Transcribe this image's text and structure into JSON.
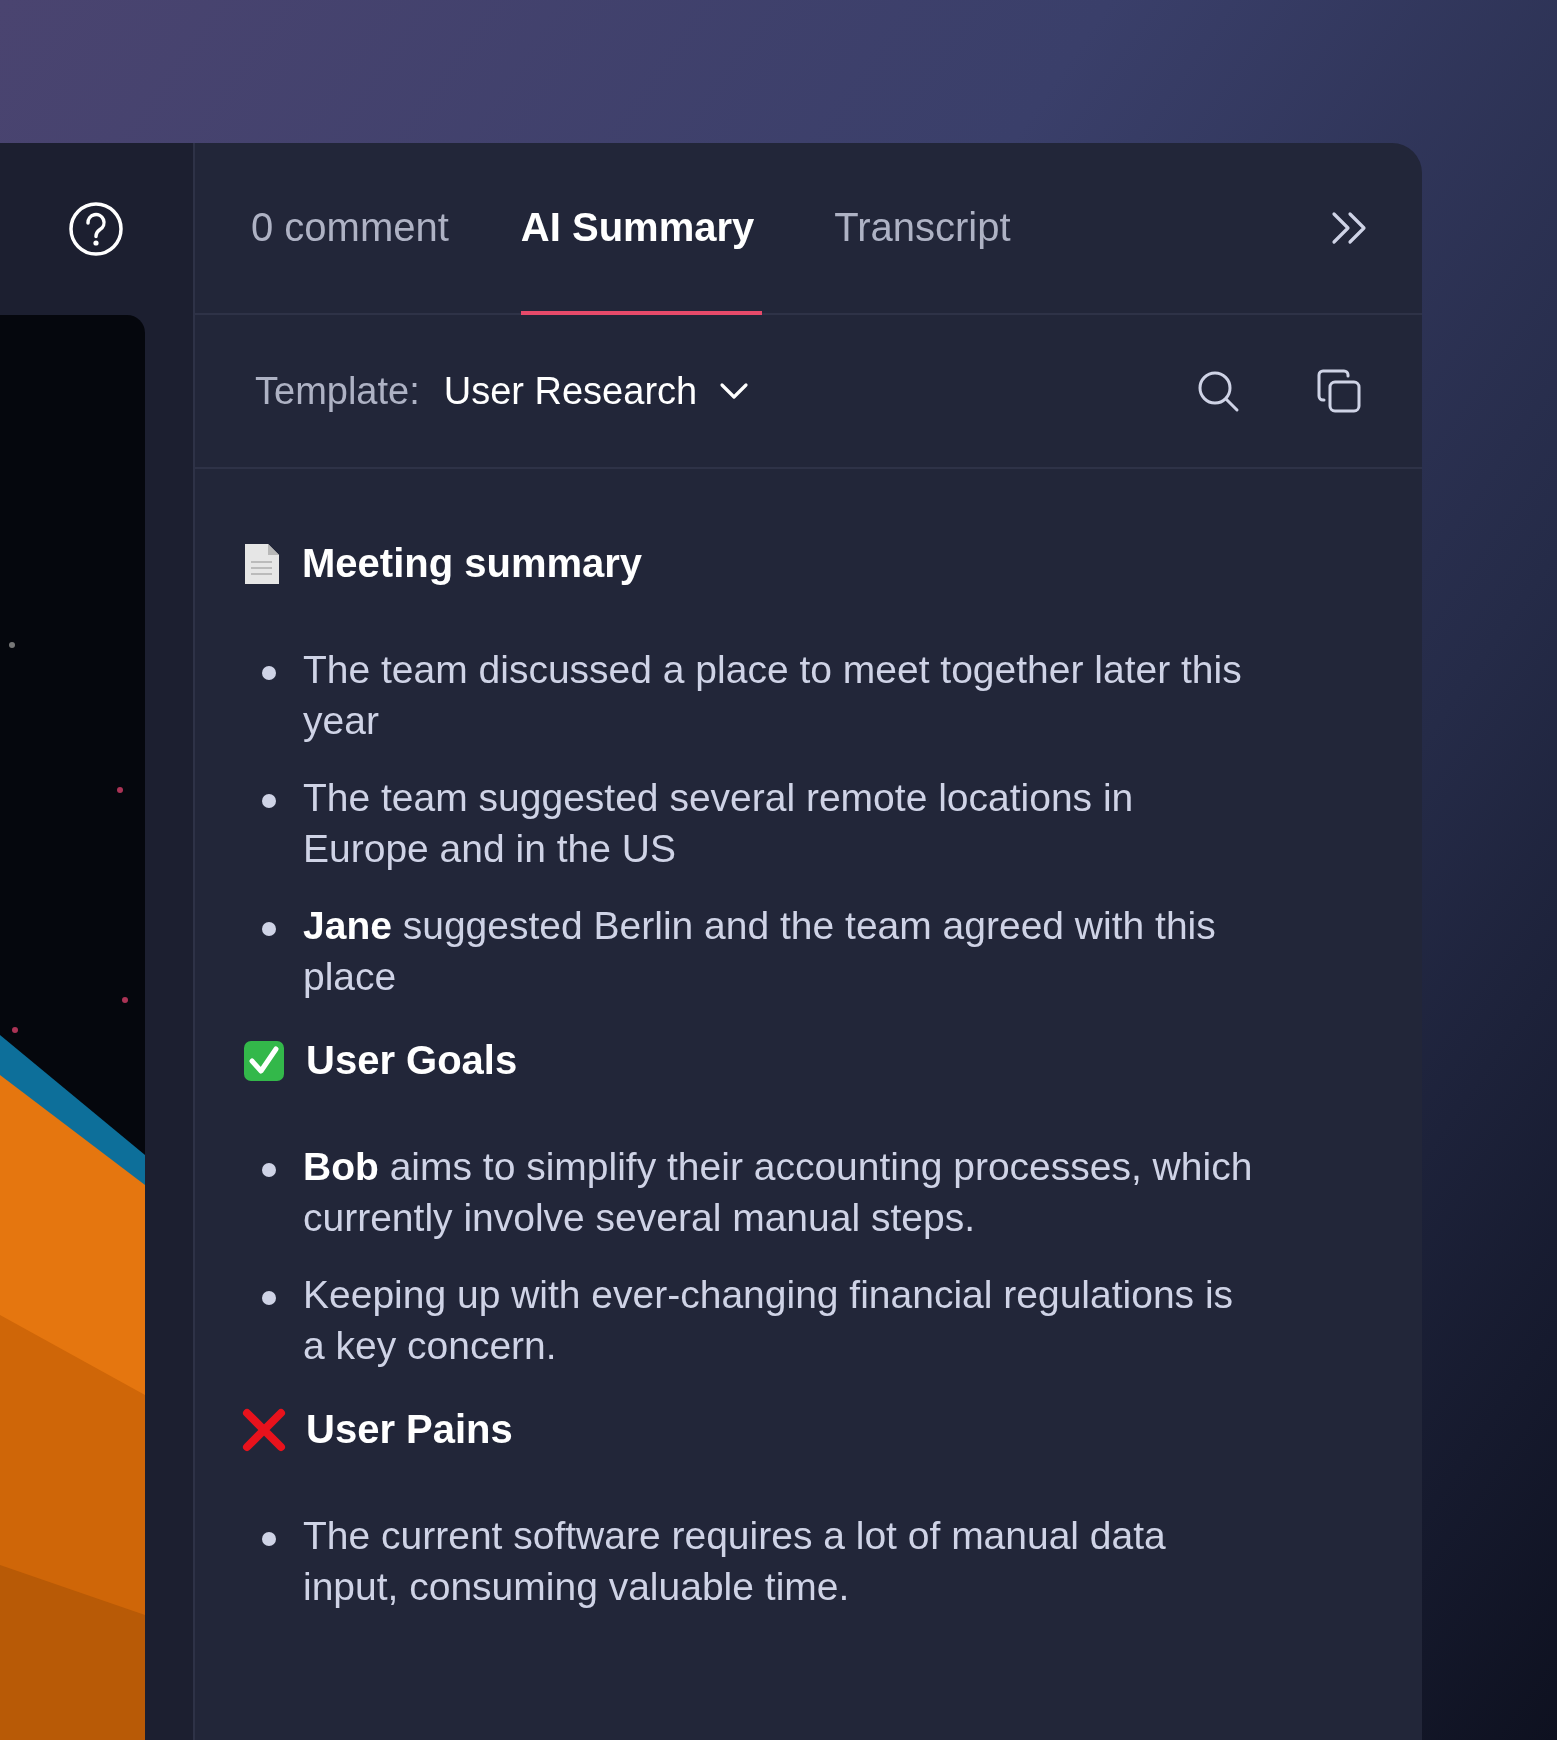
{
  "tabs": [
    {
      "label": "0 comment",
      "selected": false
    },
    {
      "label": "AI Summary",
      "selected": true
    },
    {
      "label": "Transcript",
      "selected": false
    }
  ],
  "template": {
    "label": "Template:",
    "value": "User Research"
  },
  "sections": [
    {
      "kind": "document",
      "title": "Meeting summary",
      "bullets": [
        "The team discussed a place to meet together later this year",
        "The team suggested several remote locations in Europe and in the US",
        "**Jane** suggested Berlin and the team agreed with this place"
      ]
    },
    {
      "kind": "check",
      "title": "User Goals",
      "bullets": [
        "**Bob** aims to simplify their accounting processes, which currently involve several manual steps.",
        "Keeping up with ever-changing financial regulations is a key concern."
      ]
    },
    {
      "kind": "cross",
      "title": "User Pains",
      "bullets": [
        "The current software requires a lot of manual data input, consuming valuable time."
      ]
    }
  ]
}
